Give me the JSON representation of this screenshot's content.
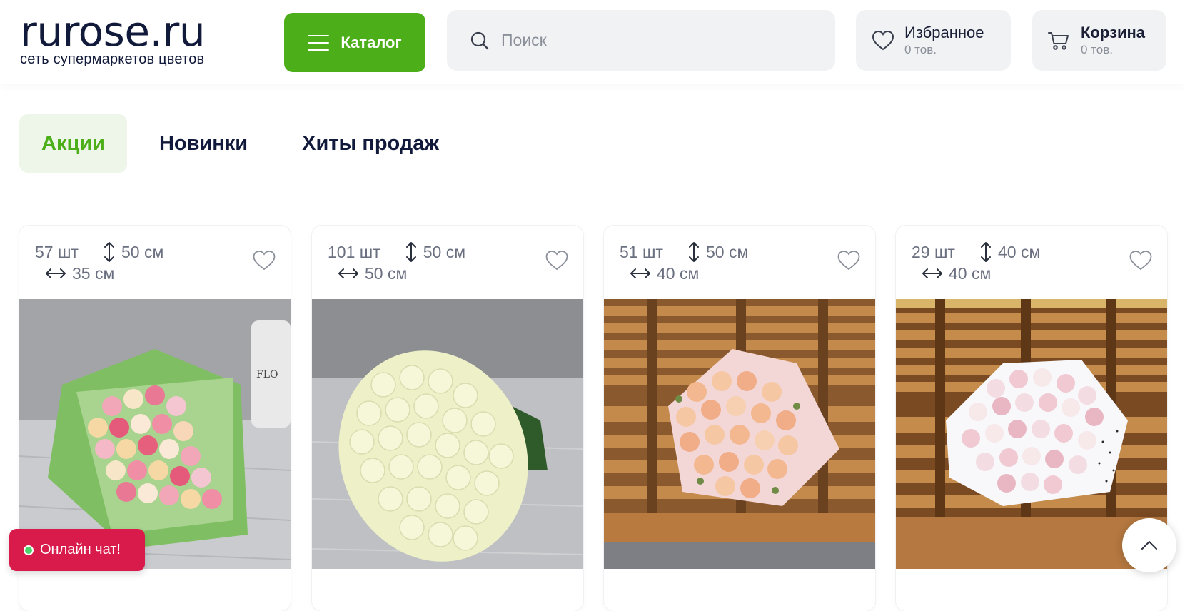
{
  "header": {
    "logo_text": "rurose.ru",
    "logo_tagline": "сеть супермаркетов цветов",
    "catalog_label": "Каталог",
    "search_placeholder": "Поиск",
    "favorites": {
      "label": "Избранное",
      "count": "0 тов."
    },
    "cart": {
      "label": "Корзина",
      "count": "0 тов."
    }
  },
  "tabs": [
    {
      "label": "Акции",
      "active": true
    },
    {
      "label": "Новинки",
      "active": false
    },
    {
      "label": "Хиты продаж",
      "active": false
    }
  ],
  "products": [
    {
      "qty": "57 шт",
      "height": "50 см",
      "width": "35 см",
      "image": "mixed-roses-bouquet"
    },
    {
      "qty": "101 шт",
      "height": "50 см",
      "width": "50 см",
      "image": "white-roses-bouquet"
    },
    {
      "qty": "51 шт",
      "height": "50 см",
      "width": "40 см",
      "image": "peach-roses-bouquet"
    },
    {
      "qty": "29 шт",
      "height": "40 см",
      "width": "40 см",
      "image": "pink-spray-roses-bouquet"
    }
  ],
  "chat": {
    "label": "Онлайн чат!"
  },
  "colors": {
    "brand_green": "#4caf1a",
    "chat_red": "#d81b4b",
    "text_dark": "#111a3a"
  }
}
